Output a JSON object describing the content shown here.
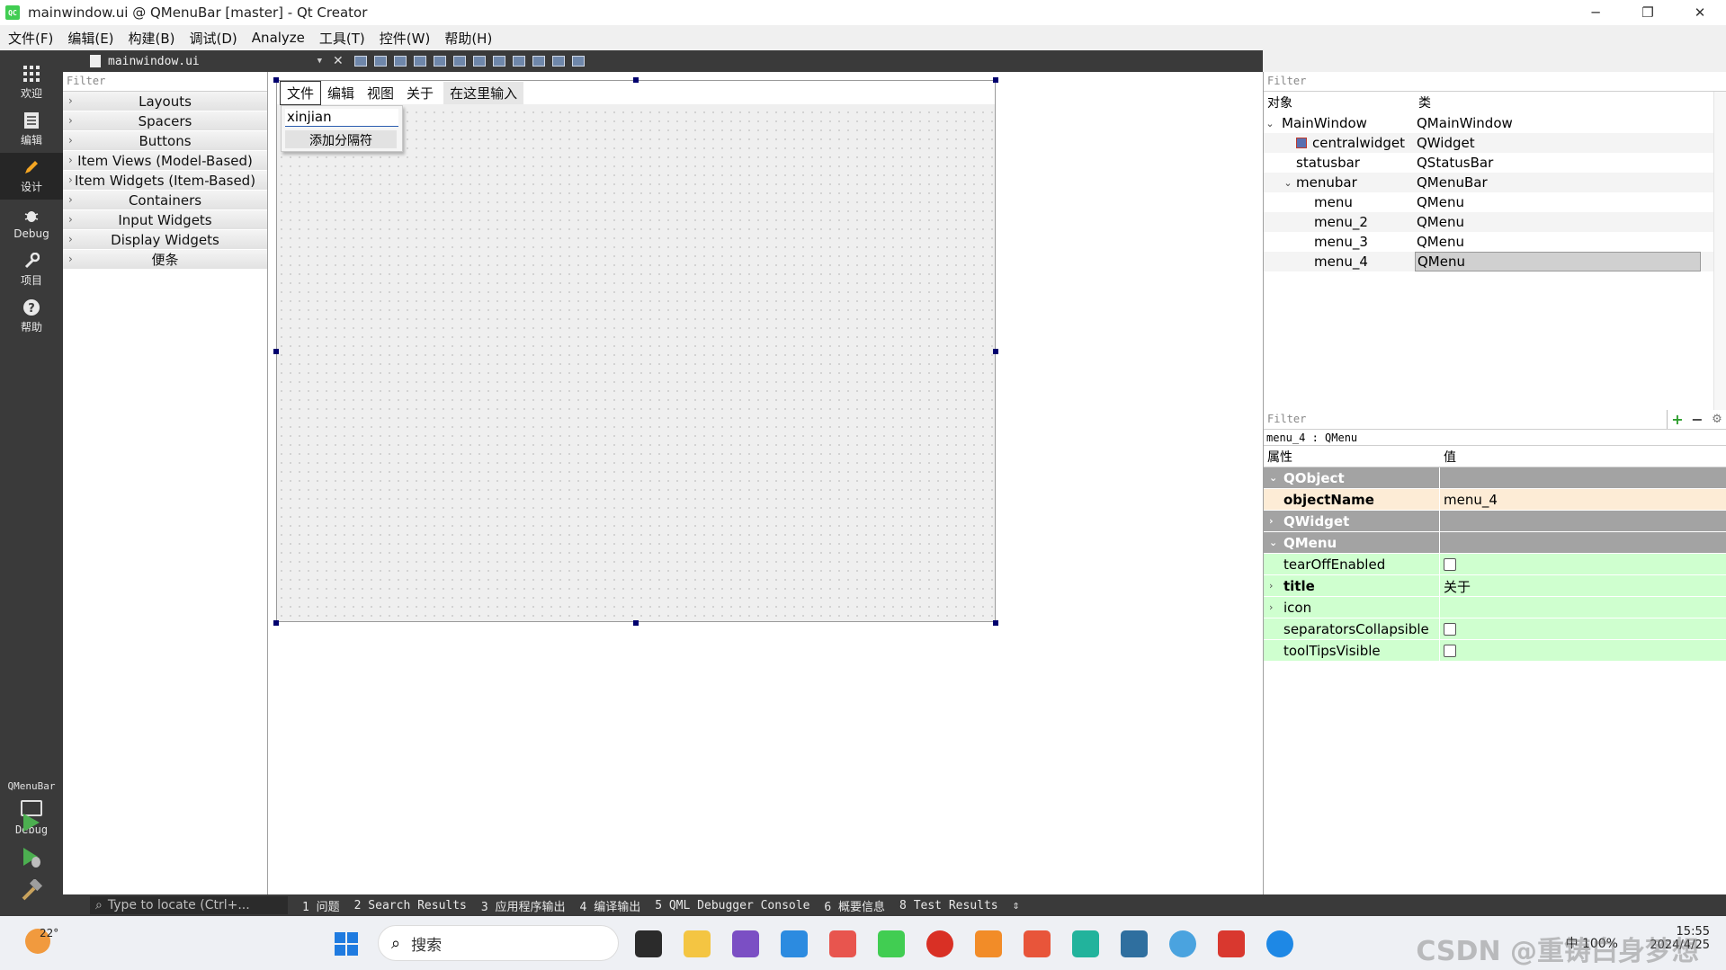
{
  "window": {
    "title": "mainwindow.ui @ QMenuBar [master] - Qt Creator",
    "app_icon_text": "QC",
    "minimize": "─",
    "maximize": "❐",
    "close": "✕"
  },
  "menubar": [
    "文件(F)",
    "编辑(E)",
    "构建(B)",
    "调试(D)",
    "Analyze",
    "工具(T)",
    "控件(W)",
    "帮助(H)"
  ],
  "modes": [
    {
      "label": "欢迎",
      "icon": "grid-icon"
    },
    {
      "label": "编辑",
      "icon": "document-icon"
    },
    {
      "label": "设计",
      "icon": "pencil-icon",
      "active": true
    },
    {
      "label": "Debug",
      "icon": "bug-icon"
    },
    {
      "label": "项目",
      "icon": "wrench-icon"
    },
    {
      "label": "帮助",
      "icon": "help-icon"
    }
  ],
  "kit": {
    "label": "QMenuBar",
    "mode": "Debug"
  },
  "editor": {
    "file": "mainwindow.ui",
    "close": "✕"
  },
  "widgetbox": {
    "filter_placeholder": "Filter",
    "categories": [
      "Layouts",
      "Spacers",
      "Buttons",
      "Item Views (Model-Based)",
      "Item Widgets (Item-Based)",
      "Containers",
      "Input Widgets",
      "Display Widgets",
      "便条"
    ]
  },
  "form": {
    "menus": [
      "文件",
      "编辑",
      "视图",
      "关于"
    ],
    "placeholder": "在这里输入",
    "dropdown_entry": "xinjian",
    "add_separator": "添加分隔符"
  },
  "object_inspector": {
    "filter_placeholder": "Filter",
    "col_object": "对象",
    "col_class": "类",
    "rows": [
      {
        "name": "MainWindow",
        "cls": "QMainWindow"
      },
      {
        "name": "centralwidget",
        "cls": "QWidget"
      },
      {
        "name": "statusbar",
        "cls": "QStatusBar"
      },
      {
        "name": "menubar",
        "cls": "QMenuBar"
      },
      {
        "name": "menu",
        "cls": "QMenu"
      },
      {
        "name": "menu_2",
        "cls": "QMenu"
      },
      {
        "name": "menu_3",
        "cls": "QMenu"
      },
      {
        "name": "menu_4",
        "cls": "QMenu"
      }
    ]
  },
  "property_editor": {
    "filter_placeholder": "Filter",
    "current": "menu_4 : QMenu",
    "col_property": "属性",
    "col_value": "值",
    "groups": {
      "qobject": "QObject",
      "qwidget": "QWidget",
      "qmenu": "QMenu"
    },
    "props": {
      "objectName": {
        "name": "objectName",
        "value": "menu_4"
      },
      "tearOffEnabled": {
        "name": "tearOffEnabled"
      },
      "title": {
        "name": "title",
        "value": "关于"
      },
      "icon": {
        "name": "icon"
      },
      "separatorsCollapsible": {
        "name": "separatorsCollapsible"
      },
      "toolTipsVisible": {
        "name": "toolTipsVisible"
      }
    }
  },
  "output_bar": {
    "locator_placeholder": "Type to locate (Ctrl+...",
    "panes": [
      "1 问题",
      "2 Search Results",
      "3 应用程序输出",
      "4 编译输出",
      "5 QML Debugger Console",
      "6 概要信息",
      "8 Test Results"
    ],
    "more": "⇕"
  },
  "taskbar": {
    "temperature": "22°",
    "search_label": "搜索",
    "tray_text": "中  100%",
    "time": "15:55",
    "date": "2024/4/25",
    "watermark": "CSDN @重铸白身梦想"
  },
  "colors": {
    "accent_green": "#41cd52",
    "selection_handle": "#00006e",
    "property_green": "#cfffcf",
    "property_orange": "#fdecd6"
  }
}
